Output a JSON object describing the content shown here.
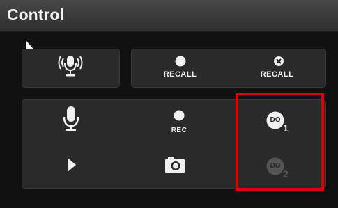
{
  "header": {
    "title": "Control"
  },
  "top_buttons": {
    "recall_record_label": "RECALL",
    "recall_cancel_label": "RECALL"
  },
  "main_buttons": {
    "rec_label": "REC",
    "do1_badge": "DO",
    "do1_number": "1",
    "do2_badge": "DO",
    "do2_number": "2"
  },
  "colors": {
    "header_bg": "#3a3a3a",
    "panel_bg": "#2a2a2a",
    "highlight": "#e10000",
    "icon_active": "#f0f0f0",
    "icon_disabled": "#555555"
  }
}
